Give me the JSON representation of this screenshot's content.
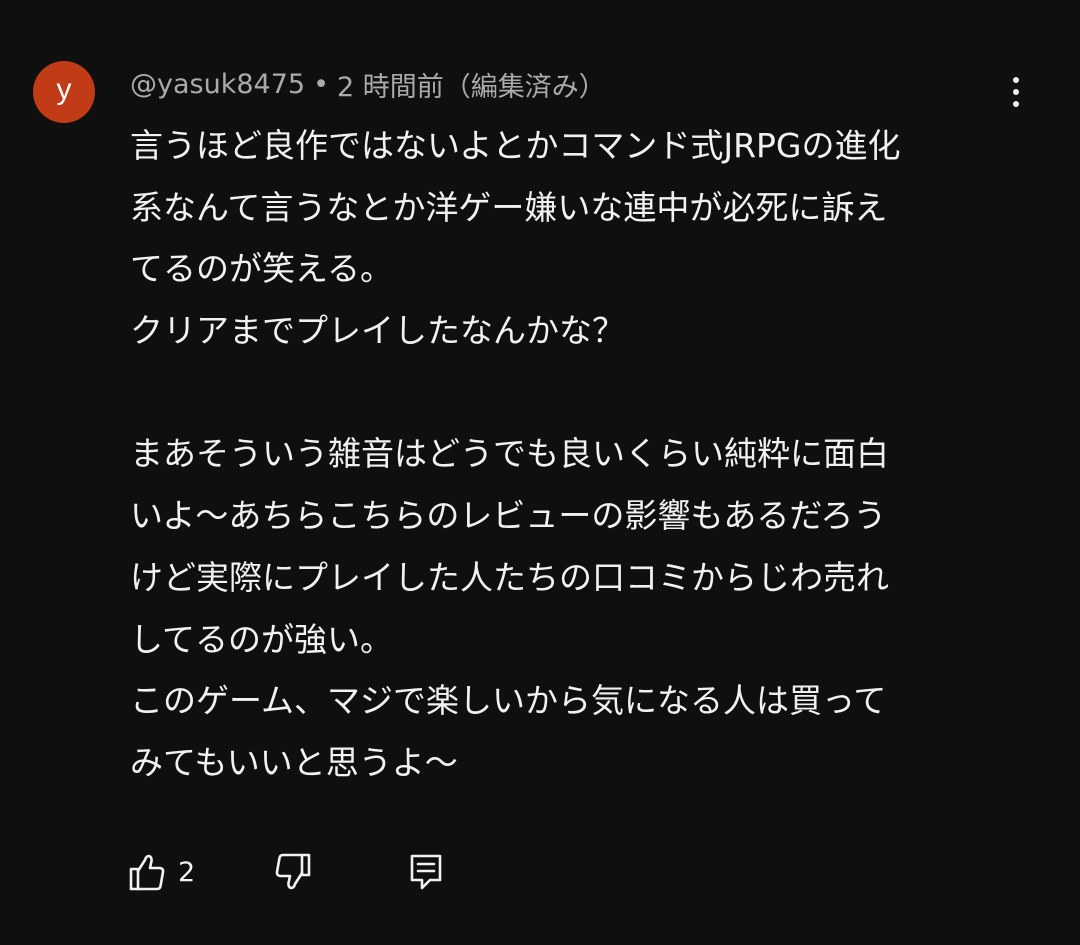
{
  "comment": {
    "avatar_letter": "y",
    "avatar_color": "#c13c16",
    "author": "@yasuk8475",
    "separator": "•",
    "time": "2 時間前（編集済み）",
    "body_lines": [
      "言うほど良作ではないよとかコマンド式JRPGの進化",
      "系なんて言うなとか洋ゲー嫌いな連中が必死に訴え",
      "てるのが笑える。",
      "クリアまでプレイしたなんかな？",
      "",
      "まあそういう雑音はどうでも良いくらい純粋に面白",
      "いよ〜あちらこちらのレビューの影響もあるだろう",
      "けど実際にプレイした人たちの口コミからじわ売れ",
      "してるのが強い。",
      "このゲーム、マジで楽しいから気になる人は買って",
      "みてもいいと思うよ〜"
    ],
    "like_count": "2"
  },
  "icons": {
    "more": "more-vertical-icon",
    "like": "thumbs-up-icon",
    "dislike": "thumbs-down-icon",
    "reply": "comment-reply-icon"
  },
  "colors": {
    "background": "#0f0f0f",
    "text_primary": "#f1f1f1",
    "text_secondary": "#aaaaaa",
    "avatar": "#c13c16"
  }
}
